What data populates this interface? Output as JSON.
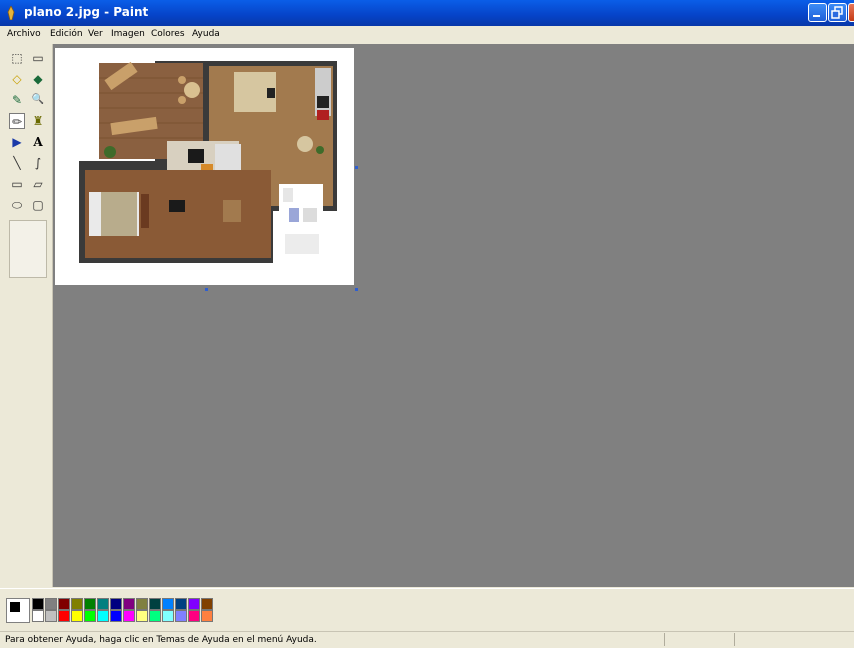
{
  "window": {
    "title": "plano 2.jpg - Paint",
    "controls": [
      "minimize",
      "restore",
      "close"
    ]
  },
  "menu": {
    "items": [
      "Archivo",
      "Edición",
      "Ver",
      "Imagen",
      "Colores",
      "Ayuda"
    ]
  },
  "toolbox": {
    "tools": [
      {
        "name": "free-form-select",
        "glyph": "⬚"
      },
      {
        "name": "select",
        "glyph": "▭"
      },
      {
        "name": "eraser",
        "glyph": "◇"
      },
      {
        "name": "fill",
        "glyph": "◆"
      },
      {
        "name": "pick-color",
        "glyph": "✎"
      },
      {
        "name": "magnifier",
        "glyph": "🔍"
      },
      {
        "name": "pencil",
        "glyph": "✏"
      },
      {
        "name": "brush",
        "glyph": "♜"
      },
      {
        "name": "airbrush",
        "glyph": "▶"
      },
      {
        "name": "text",
        "glyph": "A"
      },
      {
        "name": "line",
        "glyph": "╲"
      },
      {
        "name": "curve",
        "glyph": "∫"
      },
      {
        "name": "rectangle",
        "glyph": "▭"
      },
      {
        "name": "polygon",
        "glyph": "▱"
      },
      {
        "name": "ellipse",
        "glyph": "⬭"
      },
      {
        "name": "rounded-rectangle",
        "glyph": "▢"
      }
    ],
    "active_tool": "pencil"
  },
  "canvas": {
    "image_name": "plano 2.jpg"
  },
  "palette": {
    "foreground": "#000000",
    "background": "#ffffff",
    "row1": [
      "#000000",
      "#808080",
      "#800000",
      "#808000",
      "#008000",
      "#008080",
      "#000080",
      "#800080",
      "#808040",
      "#004040",
      "#0080ff",
      "#004080",
      "#8000ff",
      "#804000"
    ],
    "row2": [
      "#ffffff",
      "#c0c0c0",
      "#ff0000",
      "#ffff00",
      "#00ff00",
      "#00ffff",
      "#0000ff",
      "#ff00ff",
      "#ffff80",
      "#00ff80",
      "#80ffff",
      "#8080ff",
      "#ff0080",
      "#ff8040"
    ]
  },
  "status": {
    "text": "Para obtener Ayuda, haga clic en Temas de Ayuda en el menú Ayuda."
  }
}
